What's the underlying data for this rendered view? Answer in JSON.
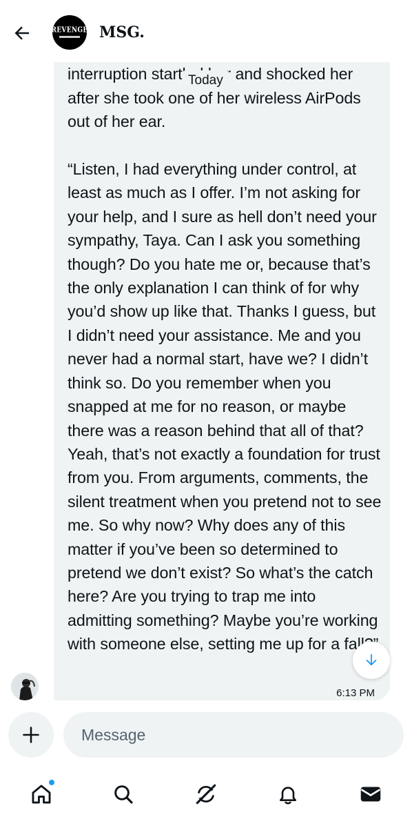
{
  "header": {
    "back_icon": "arrow-left-icon",
    "avatar_logo_text": "REVENGE",
    "conversation_name": "MSG."
  },
  "thread": {
    "date_separator": "Today",
    "message": {
      "text": "in the bathroom, she got it, her unexpected interruption startled her and shocked her after she took one of her wireless AirPods out of her ear.\n\n“Listen, I had everything under control, at least as much as I offer. I’m not asking for your help, and I sure as hell don’t need your sympathy, Taya. Can I ask you something though? Do you hate me or, because that’s the only explanation I can think of for why you’d show up like that. Thanks I guess, but I didn’t need your assistance. Me and you never had a normal start, have we? I didn’t think so. Do you remember when you snapped at me for no reason, or maybe there was a reason behind that all of that? Yeah, that’s not exactly a foundation for trust from you. From arguments, comments, the silent treatment when you pretend not to see me. So why now? Why does any of this matter if you’ve been so determined to pretend we don’t exist? So what’s the catch here? Are you trying to trap me into admitting something? Maybe you’re working with someone else, setting me up for a fall?”",
      "time": "6:13 PM"
    },
    "scroll_icon": "arrow-down-icon"
  },
  "composer": {
    "add_icon": "plus-icon",
    "placeholder": "Message"
  },
  "nav": {
    "items": [
      "home-icon",
      "search-icon",
      "grok-icon",
      "bell-icon",
      "mail-icon"
    ],
    "accent": "#1d9bf0"
  }
}
